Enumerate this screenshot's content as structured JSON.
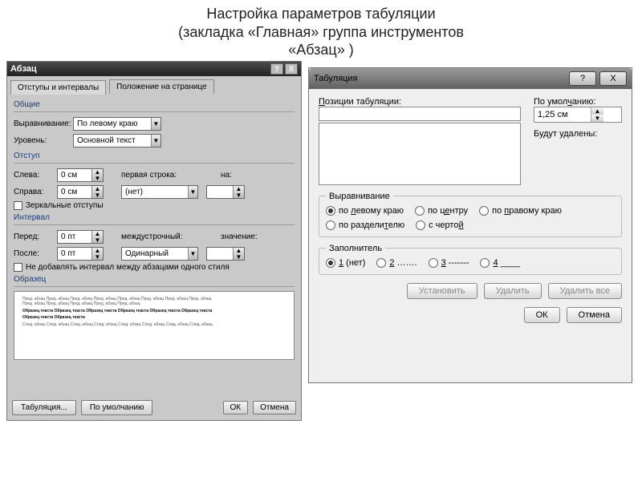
{
  "page": {
    "title_line1": "Настройка параметров табуляции",
    "title_line2": "(закладка «Главная» группа инструментов",
    "title_line3": "«Абзац» )"
  },
  "paragraph_dialog": {
    "title": "Абзац",
    "help": "?",
    "close": "X",
    "tabs": {
      "indents": "Отступы и интервалы",
      "position": "Положение на странице"
    },
    "groups": {
      "general": "Общие",
      "indent": "Отступ",
      "spacing": "Интервал",
      "sample": "Образец"
    },
    "general": {
      "align_label": "Выравнивание:",
      "align_value": "По левому краю",
      "level_label": "Уровень:",
      "level_value": "Основной текст"
    },
    "indent": {
      "left_label": "Слева:",
      "left_value": "0 см",
      "right_label": "Справа:",
      "right_value": "0 см",
      "first_line_label": "первая строка:",
      "first_line_value": "(нет)",
      "by_label": "на:",
      "by_value": "",
      "mirror": "Зеркальные отступы"
    },
    "spacing": {
      "before_label": "Перед:",
      "before_value": "0 пт",
      "after_label": "После:",
      "after_value": "0 пт",
      "line_label": "междустрочный:",
      "line_value": "Одинарный",
      "at_label": "значение:",
      "at_value": "",
      "no_space_same": "Не добавлять интервал между абзацами одного стиля"
    },
    "buttons": {
      "tabs": "Табуляция...",
      "defaults": "По умолчанию",
      "ok": "ОК",
      "cancel": "Отмена"
    }
  },
  "tab_dialog": {
    "title": "Табуляция",
    "help": "?",
    "close": "X",
    "position_label": "Позиции табуляции:",
    "position_value": "",
    "default_label": "По умолчанию:",
    "default_value": "1,25 см",
    "to_clear": "Будут удалены:",
    "alignment": {
      "legend": "Выравнивание",
      "left": "по левому краю",
      "center": "по центру",
      "right": "по правому краю",
      "decimal": "по разделителю",
      "bar": "с чертой"
    },
    "leader": {
      "legend": "Заполнитель",
      "opt1": "1 (нет)",
      "opt2": "2 …….",
      "opt3": "3 -------",
      "opt4": "4 ____"
    },
    "buttons": {
      "set": "Установить",
      "clear": "Удалить",
      "clear_all": "Удалить все",
      "ok": "ОК",
      "cancel": "Отмена"
    }
  }
}
